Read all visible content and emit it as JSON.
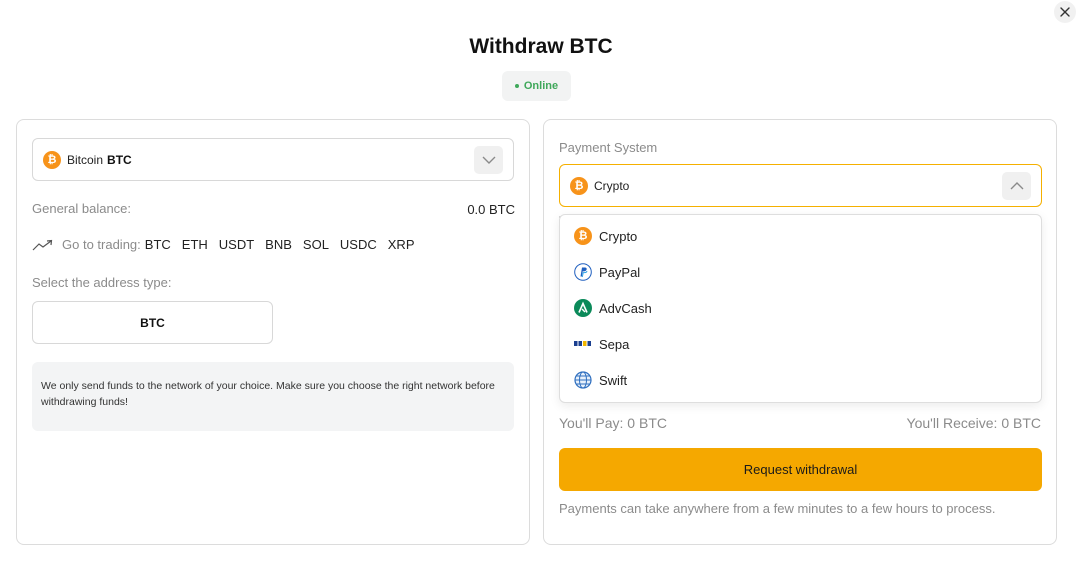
{
  "header": {
    "title": "Withdraw BTC",
    "status": "Online",
    "status_color": "#3fa85a"
  },
  "left_panel": {
    "coin": {
      "icon": "bitcoin-icon",
      "glyph": "₿",
      "name": "Bitcoin",
      "ticker": "BTC"
    },
    "balance_label": "General balance:",
    "balance_value": "0.0 BTC",
    "trading_label": "Go to trading:",
    "trading_tickers": [
      "BTC",
      "ETH",
      "USDT",
      "BNB",
      "SOL",
      "USDC",
      "XRP"
    ],
    "address_type_label": "Select the address type:",
    "address_type_value": "BTC",
    "notice": "We only send funds to the network of your choice. Make sure you choose the right network before withdrawing funds!"
  },
  "right_panel": {
    "payment_system_label": "Payment System",
    "selected": {
      "icon": "bitcoin-icon",
      "glyph": "₿",
      "label": "Crypto"
    },
    "options": [
      {
        "label": "Crypto",
        "icon": "bitcoin-icon"
      },
      {
        "label": "PayPal",
        "icon": "paypal-icon"
      },
      {
        "label": "AdvCash",
        "icon": "advcash-icon"
      },
      {
        "label": "Sepa",
        "icon": "sepa-icon"
      },
      {
        "label": "Swift",
        "icon": "globe-icon"
      }
    ],
    "pay_text": "You'll Pay: 0 BTC",
    "receive_text": "You'll Receive: 0 BTC",
    "request_button": "Request withdrawal",
    "footnote": "Payments can take anywhere from a few minutes to a few hours to process."
  },
  "colors": {
    "accent": "#f5a800",
    "select_border": "#f5b000",
    "bitcoin": "#f7931a",
    "advcash": "#0b8a5a",
    "paypal": "#1f5fbf"
  }
}
